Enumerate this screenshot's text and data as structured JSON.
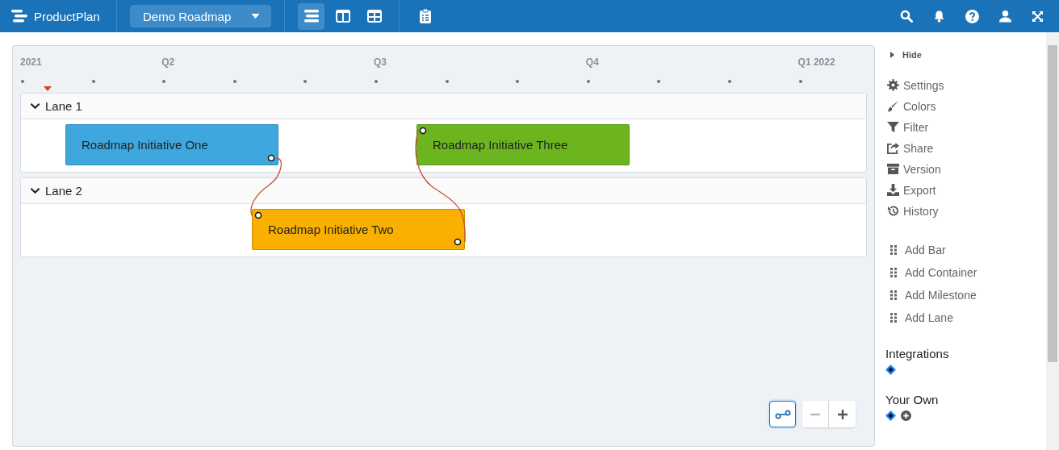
{
  "header": {
    "brand": "ProductPlan",
    "roadmap": "Demo Roadmap",
    "views": [
      {
        "selected": true
      },
      {
        "selected": false
      },
      {
        "selected": false
      }
    ]
  },
  "timeline": {
    "labels": [
      "2021",
      "Q2",
      "Q3",
      "Q4",
      "Q1 2022"
    ]
  },
  "lanes": [
    {
      "name": "Lane 1",
      "expanded": true,
      "bars": [
        {
          "label": "Roadmap Initiative One",
          "color": "#3ea8de"
        },
        {
          "label": "Roadmap Initiative Three",
          "color": "#6cb51f"
        }
      ]
    },
    {
      "name": "Lane 2",
      "expanded": true,
      "bars": [
        {
          "label": "Roadmap Initiative Two",
          "color": "#f9b000"
        }
      ]
    }
  ],
  "controls": {
    "dependencies_on": true,
    "zoom_out_disabled": true
  },
  "sidebar": {
    "hide": "Hide",
    "menu": [
      "Settings",
      "Colors",
      "Filter",
      "Share",
      "Version",
      "Export",
      "History"
    ],
    "add_items": [
      "Add Bar",
      "Add Container",
      "Add Milestone",
      "Add Lane"
    ],
    "integrations": "Integrations",
    "your_own": "Your Own"
  }
}
